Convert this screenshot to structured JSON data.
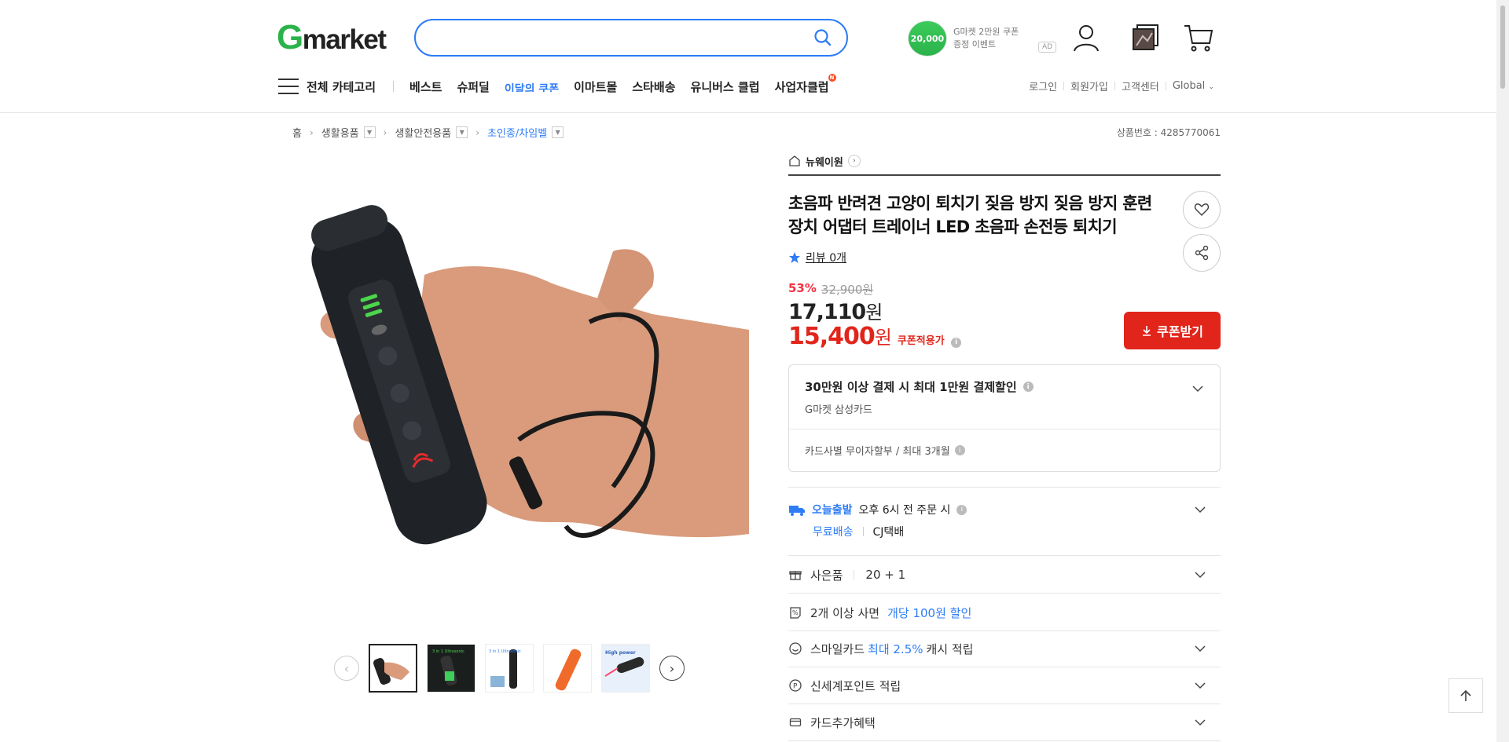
{
  "header": {
    "logo_g": "G",
    "logo_rest": "market",
    "search_placeholder": "",
    "promo": {
      "coin_text": "20,000",
      "line1": "G마켓 2만원 쿠폰",
      "line2": "증정 이벤트",
      "ad": "AD"
    }
  },
  "nav": {
    "all_categories": "전체 카테고리",
    "items": [
      "베스트",
      "슈퍼딜",
      "이달의 쿠폰",
      "이마트몰",
      "스타배송",
      "유니버스 클럽",
      "사업자클럽"
    ],
    "new_badge": "N",
    "util": [
      "로그인",
      "회원가입",
      "고객센터",
      "Global"
    ]
  },
  "breadcrumb": {
    "home": "홈",
    "level1": "생활용품",
    "level2": "생활안전용품",
    "level3": "초인종/차임벨",
    "product_no": "상품번호 : 4285770061"
  },
  "product": {
    "seller": "뉴웨이원",
    "title": "초음파 반려견 고양이 퇴치기 짖음 방지 짖음 방지 훈련 장치 어댑터 트레이너 LED 초음파 손전등 퇴치기",
    "review": "리뷰 0개",
    "discount_rate": "53%",
    "original_price": "32,900원",
    "price": "17,110",
    "price_unit": "원",
    "coupon_price": "15,400",
    "coupon_label": "쿠폰적용가",
    "coupon_button": "쿠폰받기"
  },
  "card_offer": {
    "title": "30만원 이상 결제 시 최대 1만원 결제할인",
    "card": "G마켓 삼성카드",
    "installment": "카드사별 무이자할부 / 최대 3개월"
  },
  "shipping": {
    "today_label": "오늘출발",
    "cutoff": "오후 6시 전 주문 시",
    "free": "무료배송",
    "courier": "CJ택배"
  },
  "benefits": {
    "gift_label": "사은품",
    "gift_value": "20 + 1",
    "multi_pre": "2개 이상 사면",
    "multi_blue": "개당 100원 할인",
    "smile_pre": "스마일카드",
    "smile_blue": "최대 2.5%",
    "smile_post": "캐시 적립",
    "point": "신세계포인트 적립",
    "card_extra": "카드추가혜택"
  },
  "colors": {
    "accent_blue": "#2e7cf6",
    "brand_green": "#2bb34b",
    "price_red": "#e1251b"
  }
}
